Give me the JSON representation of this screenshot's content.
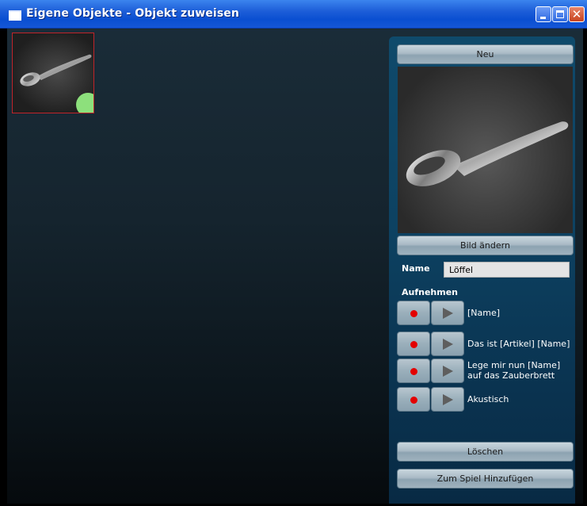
{
  "window": {
    "title": "Eigene Objekte - Objekt zuweisen"
  },
  "gallery": {
    "items": [
      {
        "name": "Löffel",
        "status_color": "#8de07c"
      }
    ]
  },
  "panel": {
    "new_button": "Neu",
    "change_image_button": "Bild ändern",
    "name_label": "Name",
    "name_value": "Löffel",
    "record_heading": "Aufnehmen",
    "recordings": [
      {
        "label": "[Name]"
      },
      {
        "label": "Das ist [Artikel] [Name]"
      },
      {
        "label_line1": "Lege mir nun [Name]",
        "label_line2": "auf das Zauberbrett"
      },
      {
        "label": "Akustisch"
      }
    ],
    "delete_button": "Löschen",
    "add_to_game_button": "Zum Spiel Hinzufügen"
  },
  "colors": {
    "titlebar": "#0a4fd1",
    "panel": "#0d4262",
    "record": "#e30000",
    "status_ok": "#8de07c"
  }
}
